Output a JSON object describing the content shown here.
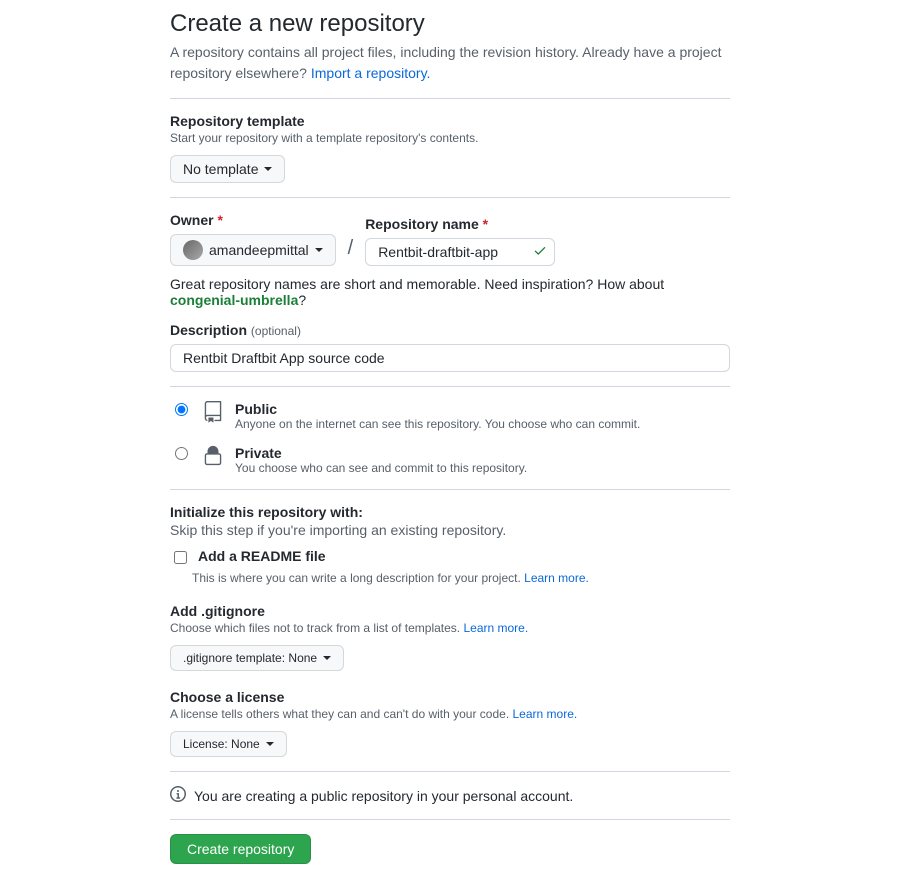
{
  "header": {
    "title": "Create a new repository",
    "subhead_pre": "A repository contains all project files, including the revision history. Already have a project repository elsewhere? ",
    "import_link": "Import a repository."
  },
  "template": {
    "label": "Repository template",
    "help": "Start your repository with a template repository's contents.",
    "button": "No template"
  },
  "owner": {
    "label": "Owner",
    "name": "amandeepmittal"
  },
  "repo": {
    "label": "Repository name",
    "value": "Rentbit-draftbit-app"
  },
  "name_tip": {
    "pre": "Great repository names are short and memorable. Need inspiration? How about ",
    "suggestion": "congenial-umbrella",
    "post": "?"
  },
  "description": {
    "label": "Description",
    "optional": "(optional)",
    "value": "Rentbit Draftbit App source code"
  },
  "visibility": {
    "public": {
      "title": "Public",
      "desc": "Anyone on the internet can see this repository. You choose who can commit."
    },
    "private": {
      "title": "Private",
      "desc": "You choose who can see and commit to this repository."
    }
  },
  "init": {
    "title": "Initialize this repository with:",
    "help": "Skip this step if you're importing an existing repository.",
    "readme": {
      "title": "Add a README file",
      "desc_pre": "This is where you can write a long description for your project. ",
      "learn": "Learn more."
    }
  },
  "gitignore": {
    "title": "Add .gitignore",
    "help_pre": "Choose which files not to track from a list of templates. ",
    "learn": "Learn more.",
    "button_pre": ".gitignore template: ",
    "button_val": "None"
  },
  "license": {
    "title": "Choose a license",
    "help_pre": "A license tells others what they can and can't do with your code. ",
    "learn": "Learn more.",
    "button_pre": "License: ",
    "button_val": "None"
  },
  "footer": {
    "info": "You are creating a public repository in your personal account.",
    "submit": "Create repository"
  }
}
